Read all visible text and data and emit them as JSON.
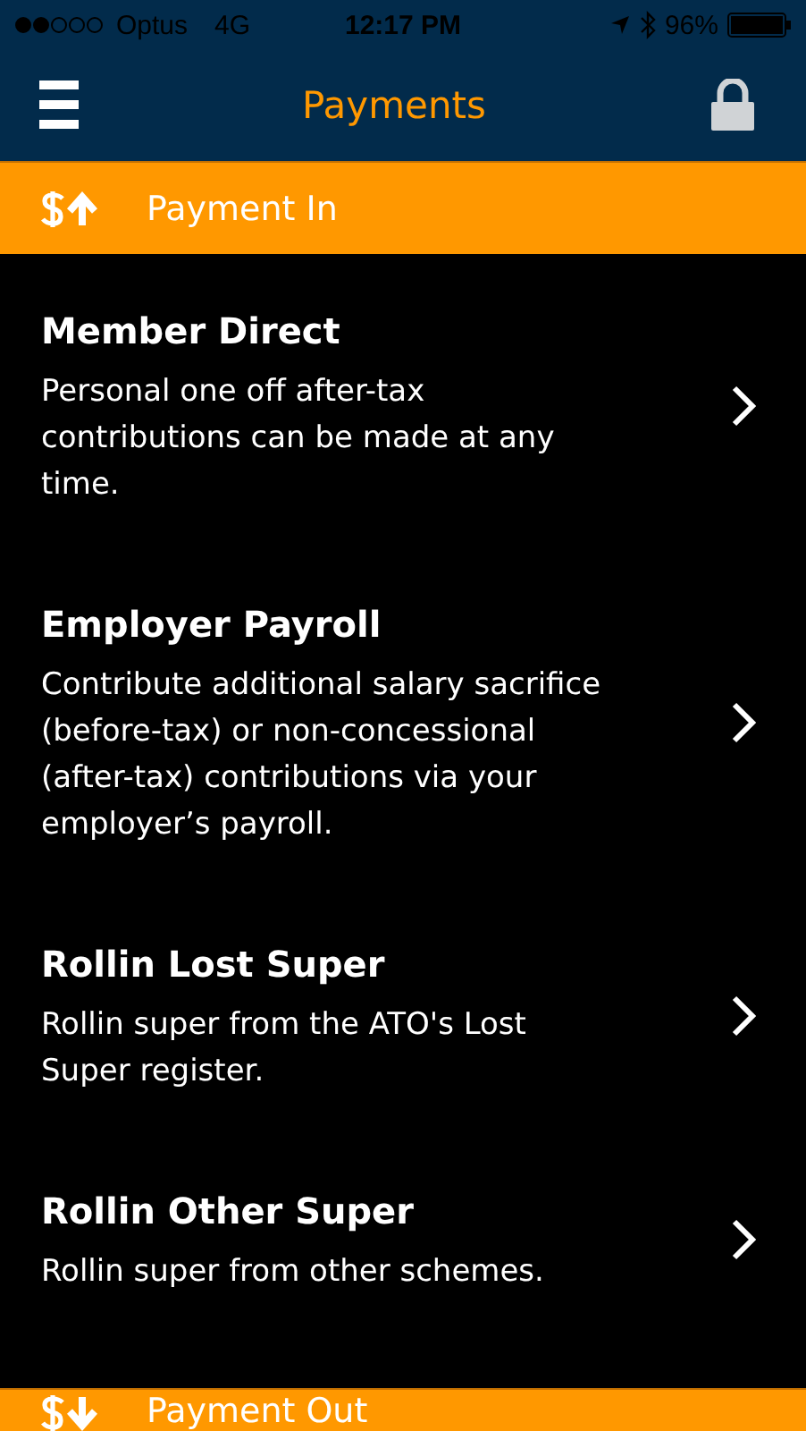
{
  "status_bar": {
    "carrier": "Optus",
    "network": "4G",
    "time": "12:17 PM",
    "battery": "96%"
  },
  "nav": {
    "title": "Payments"
  },
  "sections": [
    {
      "title": "Payment In",
      "kind": "in",
      "items": [
        {
          "title": "Member Direct",
          "description": "Personal one off after-tax contributions can be made at any time."
        },
        {
          "title": "Employer Payroll",
          "description": "Contribute additional salary sacrifice (before-tax) or non-concessional (after-tax) contributions via your employer’s payroll."
        },
        {
          "title": "Rollin Lost Super",
          "description": "Rollin super from the ATO's Lost Super register."
        },
        {
          "title": "Rollin Other Super",
          "description": "Rollin super from other schemes."
        }
      ]
    },
    {
      "title": "Payment Out",
      "kind": "out"
    }
  ]
}
